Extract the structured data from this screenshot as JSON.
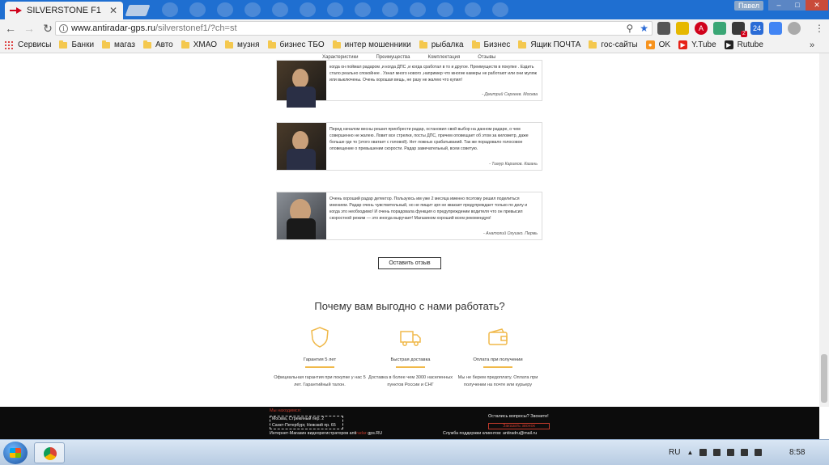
{
  "browser": {
    "tab_title": "SILVERSTONE F1",
    "tab_close": "✕",
    "profile_name": "Павел",
    "url_host": "www.antiradar-gps.ru",
    "url_path": "/silverstonef1/?ch=st"
  },
  "bookmarks": [
    {
      "label": "Сервисы",
      "kind": "apps"
    },
    {
      "label": "Банки",
      "kind": "folder"
    },
    {
      "label": "магаз",
      "kind": "folder"
    },
    {
      "label": "Авто",
      "kind": "folder"
    },
    {
      "label": "ХМАО",
      "kind": "folder"
    },
    {
      "label": "музня",
      "kind": "folder"
    },
    {
      "label": "бизнес ТБО",
      "kind": "folder"
    },
    {
      "label": "интер мошенники",
      "kind": "folder"
    },
    {
      "label": "рыбалка",
      "kind": "folder"
    },
    {
      "label": "Бизнес",
      "kind": "folder"
    },
    {
      "label": "Ящик ПОЧТА",
      "kind": "folder"
    },
    {
      "label": "гос-сайты",
      "kind": "folder"
    },
    {
      "label": "OK",
      "kind": "ok-icon"
    },
    {
      "label": "Y.Tube",
      "kind": "youtube-icon"
    },
    {
      "label": "Rutube",
      "kind": "rutube-icon"
    }
  ],
  "page": {
    "mini_nav": [
      "Характеристики",
      "Преимущества",
      "Комплектация",
      "Отзывы"
    ],
    "reviews": [
      {
        "text": "когда он поймал радаром ,и когда ДПС ,и когда сработал в то и другое. Преимуществ в покупке . Ездить стало реально спокойнее . Узнал много нового ,например что многие камеры не работают или они муляж или выключены. Очень хорошая вещь, не разу не жалею что купил!",
        "author": "- Дмитрий Сергеев. Москва"
      },
      {
        "text": "Перед началом весны решил приобрести радар, остановил свой выбор на данном радаре, о чем совершенно не жалею. Ловит все стрелки, посты ДПС, причем оповещает об этом за километр, даже больше где то (этого хватает с головой). Нет ложных срабатываний. Так же порадовало голосовое оповещение о превышении скорости. Радар замечательный, всем советую.",
        "author": "- Тимур Каримов. Казань"
      },
      {
        "text": "Очень хороший радар детектор. Пользуюсь им уже 2 месяца именно поэтому решил поделиться мнением. Радар очень чувствительный, но не пищит зря не квакает предупреждает только по делу и когда это необходимо! И очень порадовала функция о предупреждении водителя что он превысил скоростной режим — это иногда выручает! Магазином хороший всем рекомендую!",
        "author": "- Анатолий Огушко. Пермь"
      }
    ],
    "leave_review_button": "Оставить отзыв",
    "why_title": "Почему вам выгодно с нами работать?",
    "features": [
      {
        "title": "Гарантия 5 лет",
        "desc": "Официальная гарантия при покупке у нас 5 лет. Гарантийный талон.",
        "icon": "shield-icon"
      },
      {
        "title": "Быстрая доставка",
        "desc": "Доставка в более чем 3000 населенных пунктов России и СНГ",
        "icon": "truck-icon"
      },
      {
        "title": "Оплата при получении",
        "desc": "Мы не берем предоплату. Оплата при получении на почте или курьеру",
        "icon": "wallet-icon"
      }
    ],
    "accent_color": "#f0b94a"
  },
  "footer": {
    "contacts_label": "Мы находимся:",
    "address_line1": "Москва, Стремяный пер. 2",
    "address_line2": "Санкт-Петербург, Невский пр. 65",
    "shop_prefix": "Интернет-Магазин видеорегистраторов ",
    "shop_domain_a": "anti",
    "shop_domain_b": "radar-",
    "shop_domain_c": "gps",
    "shop_domain_d": ".RU",
    "question": "Остались вопросы? Звоните!",
    "call_button": "Заказать звонок",
    "support": "Служба поддержки клиентов: antiradru@mail.ru",
    "accent_color": "#c0392b"
  },
  "taskbar": {
    "lang": "RU",
    "clock": "8:58"
  }
}
